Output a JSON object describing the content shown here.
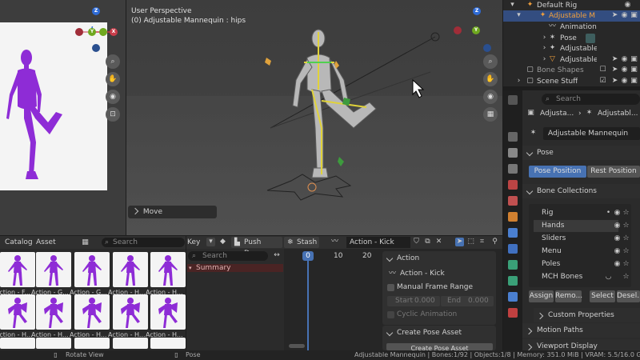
{
  "viewport": {
    "title": "User Perspective",
    "subtitle": "(0) Adjustable Mannequin : hips",
    "move_panel": "Move"
  },
  "gizmo": {
    "z": "Z",
    "y": "Y",
    "x": "X"
  },
  "outliner": {
    "rows": [
      "Default Rig",
      "Adjustable Man",
      "Animation",
      "Pose",
      "Adjustable M",
      "Adjustable M",
      "Bone Shapes",
      "Scene Stuff"
    ]
  },
  "properties": {
    "search_placeholder": "Search",
    "breadcrumb_object": "Adjusta...",
    "breadcrumb_armature": "Adjustabl...",
    "armature_name": "Adjustable Mannequin",
    "pose_panel": "Pose",
    "pose_position": "Pose Position",
    "rest_position": "Rest Position",
    "bone_collections_panel": "Bone Collections",
    "bone_collections": [
      "Rig",
      "Hands",
      "Sliders",
      "Menu",
      "Poles",
      "MCH Bones"
    ],
    "assign": "Assign",
    "remove": "Remo...",
    "select": "Select",
    "deselect": "Desel...",
    "custom_properties": "Custom Properties",
    "motion_paths": "Motion Paths",
    "viewport_display": "Viewport Display"
  },
  "asset_browser": {
    "menu_catalog": "Catalog",
    "menu_asset": "Asset",
    "search_placeholder": "Search",
    "labels_row1": [
      "Action - F...",
      "Action - G...",
      "Action - G...",
      "Action - H...",
      "Action - H..."
    ],
    "labels_row2": [
      "Action - H...",
      "Action - H...",
      "Action - H...",
      "Action - H...",
      "Action - H..."
    ]
  },
  "action_editor": {
    "mode": "Key",
    "push_down": "Push Down",
    "stash": "Stash",
    "action_name": "Action - Kick",
    "search_placeholder": "Search",
    "summary": "Summary",
    "frames": [
      "0",
      "10",
      "20"
    ],
    "sidebar": {
      "action_panel": "Action",
      "action_value": "Action - Kick",
      "manual_frame_range": "Manual Frame Range",
      "start_label": "Start",
      "start_value": "0.000",
      "end_label": "End",
      "end_value": "0.000",
      "cyclic": "Cyclic Animation",
      "create_pose_asset_panel": "Create Pose Asset",
      "create_pose_asset_button": "Create Pose Asset"
    }
  },
  "status_bar": {
    "rotate_view": "Rotate View",
    "pose": "Pose",
    "info": "Adjustable Mannequin | Bones:1/92 | Objects:1/8 | Memory: 351.0 MiB | VRAM: 5.5/16.0 GiB | 4."
  },
  "colors": {
    "accent_blue": "#4772b3",
    "mannequin_purple": "#8e2cd6",
    "orange_text": "#f2a03d",
    "header_bg": "#303030"
  }
}
